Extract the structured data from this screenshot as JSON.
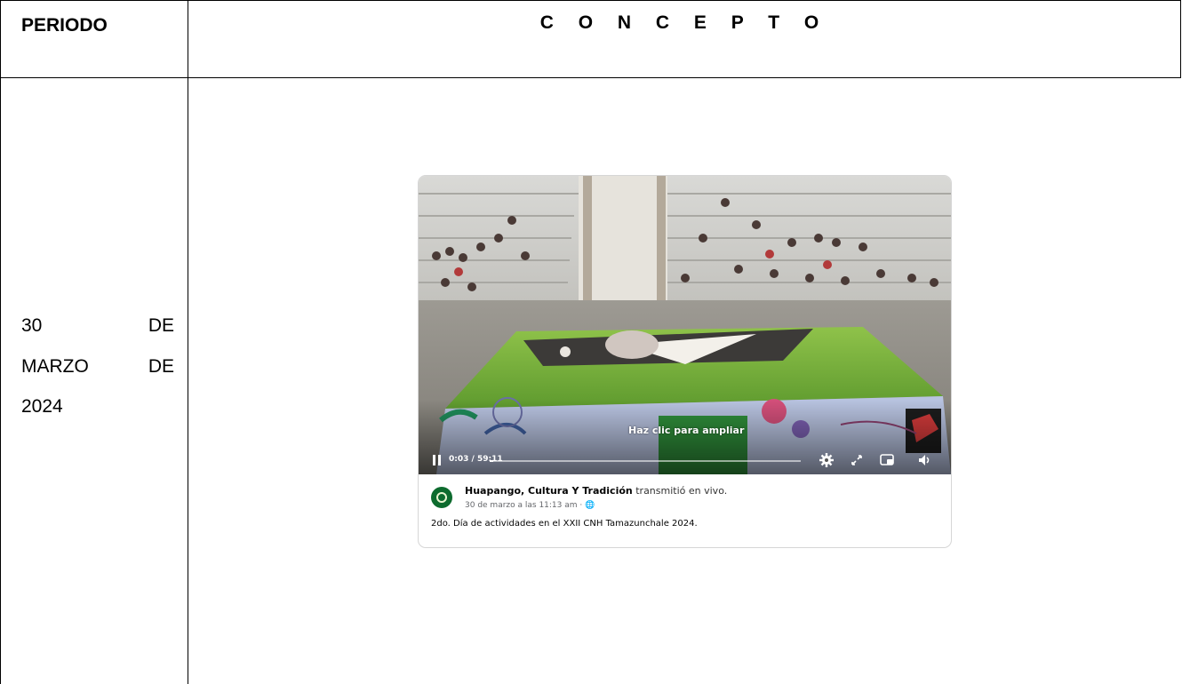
{
  "header": {
    "periodo": "PERIODO",
    "concepto": "C O N C E P T O"
  },
  "row": {
    "date_lines": [
      [
        "30",
        "DE"
      ],
      [
        "MARZO",
        "DE"
      ],
      [
        "2024",
        ""
      ]
    ]
  },
  "post": {
    "video": {
      "tooltip": "Haz clic para ampliar",
      "time": "0:03 / 59:11",
      "progress": 0.0009
    },
    "page_name": "Huapango, Cultura Y Tradición",
    "action": "transmitió en vivo.",
    "date": "30 de marzo a las 11:13 am · 🌐",
    "description": "2do. Día de actividades en el XXII CNH Tamazunchale 2024."
  }
}
